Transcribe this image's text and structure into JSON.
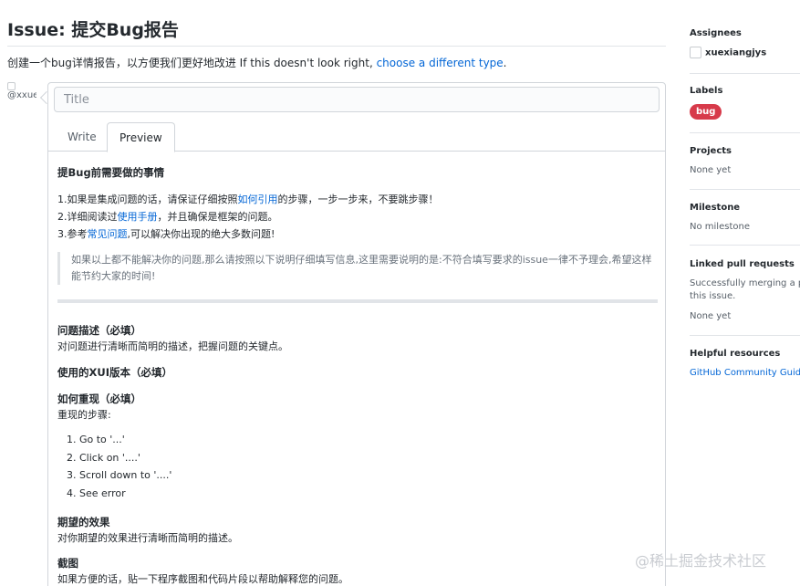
{
  "header": {
    "title": "Issue: 提交Bug报告",
    "subtitle_text": "创建一个bug详情报告，以方便我们更好地改进 If this doesn't look right, ",
    "subtitle_link": "choose a different type",
    "subtitle_end": "."
  },
  "avatar": {
    "alt": "@xxuexiangjys"
  },
  "editor": {
    "title_placeholder": "Title",
    "tabs": {
      "write": "Write",
      "preview": "Preview"
    }
  },
  "preview": {
    "heading1": "提Bug前需要做的事情",
    "step1_pre": "1.如果是集成问题的话，请保证仔细按照",
    "step1_link": "如何引用",
    "step1_post": "的步骤，一步一步来，不要跳步骤！",
    "step2_pre": "2.详细阅读过",
    "step2_link": "使用手册",
    "step2_post": "，并且确保是框架的问题。",
    "step3_pre": "3.参考",
    "step3_link": "常见问题",
    "step3_post": ",可以解决你出现的绝大多数问题!",
    "quote": "如果以上都不能解决你的问题,那么请按照以下说明仔细填写信息,这里需要说明的是:不符合填写要求的issue一律不予理会,希望这样能节约大家的时间!",
    "desc_heading": "问题描述（必填）",
    "desc_text": "对问题进行清晰而简明的描述，把握问题的关键点。",
    "version_heading": "使用的XUI版本（必填）",
    "repro_heading": "如何重现（必填）",
    "repro_text": "重现的步骤:",
    "repro_steps": [
      "1. Go to '...'",
      "2. Click on '....'",
      "3. Scroll down to '....'",
      "4. See error"
    ],
    "expected_heading": "期望的效果",
    "expected_text": "对你期望的效果进行清晰而简明的描述。",
    "screenshot_heading": "截图",
    "screenshot_text": "如果方便的话，贴一下程序截图和代码片段以帮助解释您的问题。"
  },
  "sidebar": {
    "assignees_label": "Assignees",
    "assignee": "xuexiangjys",
    "labels_label": "Labels",
    "label_bug": "bug",
    "label_color": "#d73a4a",
    "projects_label": "Projects",
    "projects_value": "None yet",
    "milestone_label": "Milestone",
    "milestone_value": "No milestone",
    "linked_label": "Linked pull requests",
    "linked_text1": "Successfully merging a pul",
    "linked_text2": "this issue.",
    "linked_value": "None yet",
    "helpful_label": "Helpful resources",
    "helpful_link": "GitHub Community Guideli"
  },
  "watermark": "@稀土掘金技术社区"
}
